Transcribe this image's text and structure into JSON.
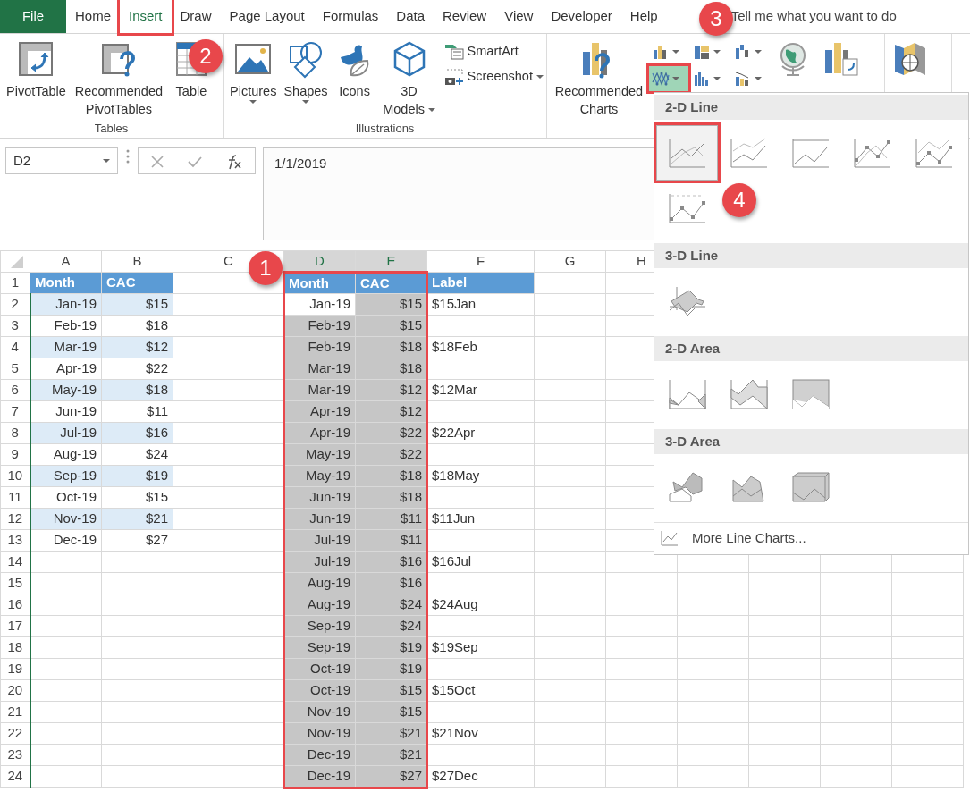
{
  "ribbon_tabs": [
    {
      "label": "File",
      "kind": "file",
      "selected": false,
      "annotated": false
    },
    {
      "label": "Home",
      "kind": "tab",
      "selected": false,
      "annotated": false
    },
    {
      "label": "Insert",
      "kind": "tab",
      "selected": true,
      "annotated": true
    },
    {
      "label": "Draw",
      "kind": "tab",
      "selected": false,
      "annotated": false
    },
    {
      "label": "Page Layout",
      "kind": "tab",
      "selected": false,
      "annotated": false
    },
    {
      "label": "Formulas",
      "kind": "tab",
      "selected": false,
      "annotated": false
    },
    {
      "label": "Data",
      "kind": "tab",
      "selected": false,
      "annotated": false
    },
    {
      "label": "Review",
      "kind": "tab",
      "selected": false,
      "annotated": false
    },
    {
      "label": "View",
      "kind": "tab",
      "selected": false,
      "annotated": false
    },
    {
      "label": "Developer",
      "kind": "tab",
      "selected": false,
      "annotated": false
    },
    {
      "label": "Help",
      "kind": "tab",
      "selected": false,
      "annotated": false
    }
  ],
  "tell_me": "Tell me what you want to do",
  "ribbon_groups": [
    {
      "label": "Tables",
      "buttons": [
        {
          "kind": "pivottable",
          "label": "PivotTable"
        },
        {
          "kind": "recpivot",
          "label": "Recommended PivotTables"
        },
        {
          "kind": "table",
          "label": "Table"
        }
      ]
    },
    {
      "label": "Illustrations",
      "buttons": [
        {
          "kind": "pictures",
          "label": "Pictures",
          "caret": true
        },
        {
          "kind": "shapes",
          "label": "Shapes",
          "caret": true
        },
        {
          "kind": "icons",
          "label": "Icons",
          "caret": false
        },
        {
          "kind": "models",
          "label": "3D Models",
          "caret": true
        }
      ],
      "small_buttons": [
        {
          "kind": "smartart",
          "label": "SmartArt",
          "caret": false
        },
        {
          "kind": "screenshot",
          "label": "Screenshot",
          "caret": true
        }
      ]
    },
    {
      "buttons": [
        {
          "kind": "recchart",
          "label": "Recommended Charts"
        }
      ],
      "chart_buttons": [
        {
          "kind": "column",
          "selected": false,
          "annotated": false
        },
        {
          "kind": "hierarchy",
          "selected": false,
          "annotated": false
        },
        {
          "kind": "waterfall",
          "selected": false,
          "annotated": false
        },
        {
          "kind": "line",
          "selected": true,
          "annotated": true
        },
        {
          "kind": "bars",
          "selected": false,
          "annotated": false
        },
        {
          "kind": "combo",
          "selected": false,
          "annotated": false
        }
      ],
      "more_buttons": [
        {
          "kind": "maps"
        },
        {
          "kind": "pivotchart"
        }
      ]
    },
    {
      "buttons": [
        {
          "kind": "map3d"
        }
      ]
    }
  ],
  "name_box": "D2",
  "formula": "1/1/2019",
  "columns": [
    {
      "label": "A",
      "selected": false
    },
    {
      "label": "B",
      "selected": false
    },
    {
      "label": "C",
      "selected": false
    },
    {
      "label": "D",
      "selected": true
    },
    {
      "label": "E",
      "selected": true
    },
    {
      "label": "F",
      "selected": false
    },
    {
      "label": "G",
      "selected": false
    },
    {
      "label": "H",
      "selected": false
    }
  ],
  "range_outlined": true,
  "rows": [
    {
      "num": "1",
      "selected": false,
      "cells": [
        {
          "text": "Month",
          "kind": "header"
        },
        {
          "text": "CAC",
          "kind": "header"
        },
        null,
        {
          "text": "Month",
          "kind": "header"
        },
        {
          "text": "CAC",
          "kind": "header"
        },
        {
          "text": "Label",
          "kind": "header"
        },
        null,
        null
      ]
    },
    {
      "num": "2",
      "selected": true,
      "cells": [
        {
          "text": "Jan-19",
          "kind": "band",
          "right_aligned": true
        },
        {
          "text": "$15",
          "kind": "band",
          "right_aligned": true
        },
        null,
        {
          "text": "Jan-19",
          "kind": "active",
          "right_aligned": true
        },
        {
          "text": "$15",
          "kind": "sel",
          "right_aligned": true
        },
        {
          "text": "$15Jan",
          "kind": "plain"
        },
        null,
        null
      ]
    },
    {
      "num": "3",
      "selected": true,
      "cells": [
        {
          "text": "Feb-19",
          "kind": "plain",
          "right_aligned": true
        },
        {
          "text": "$18",
          "kind": "plain",
          "right_aligned": true
        },
        null,
        {
          "text": "Feb-19",
          "kind": "sel",
          "right_aligned": true
        },
        {
          "text": "$15",
          "kind": "sel",
          "right_aligned": true
        },
        null,
        null,
        null
      ]
    },
    {
      "num": "4",
      "selected": true,
      "cells": [
        {
          "text": "Mar-19",
          "kind": "band",
          "right_aligned": true
        },
        {
          "text": "$12",
          "kind": "band",
          "right_aligned": true
        },
        null,
        {
          "text": "Feb-19",
          "kind": "sel",
          "right_aligned": true
        },
        {
          "text": "$18",
          "kind": "sel",
          "right_aligned": true
        },
        {
          "text": "$18Feb",
          "kind": "plain"
        },
        null,
        null
      ]
    },
    {
      "num": "5",
      "selected": true,
      "cells": [
        {
          "text": "Apr-19",
          "kind": "plain",
          "right_aligned": true
        },
        {
          "text": "$22",
          "kind": "plain",
          "right_aligned": true
        },
        null,
        {
          "text": "Mar-19",
          "kind": "sel",
          "right_aligned": true
        },
        {
          "text": "$18",
          "kind": "sel",
          "right_aligned": true
        },
        null,
        null,
        null
      ]
    },
    {
      "num": "6",
      "selected": true,
      "cells": [
        {
          "text": "May-19",
          "kind": "band",
          "right_aligned": true
        },
        {
          "text": "$18",
          "kind": "band",
          "right_aligned": true
        },
        null,
        {
          "text": "Mar-19",
          "kind": "sel",
          "right_aligned": true
        },
        {
          "text": "$12",
          "kind": "sel",
          "right_aligned": true
        },
        {
          "text": "$12Mar",
          "kind": "plain"
        },
        null,
        null
      ]
    },
    {
      "num": "7",
      "selected": true,
      "cells": [
        {
          "text": "Jun-19",
          "kind": "plain",
          "right_aligned": true
        },
        {
          "text": "$11",
          "kind": "plain",
          "right_aligned": true
        },
        null,
        {
          "text": "Apr-19",
          "kind": "sel",
          "right_aligned": true
        },
        {
          "text": "$12",
          "kind": "sel",
          "right_aligned": true
        },
        null,
        null,
        null
      ]
    },
    {
      "num": "8",
      "selected": true,
      "cells": [
        {
          "text": "Jul-19",
          "kind": "band",
          "right_aligned": true
        },
        {
          "text": "$16",
          "kind": "band",
          "right_aligned": true
        },
        null,
        {
          "text": "Apr-19",
          "kind": "sel",
          "right_aligned": true
        },
        {
          "text": "$22",
          "kind": "sel",
          "right_aligned": true
        },
        {
          "text": "$22Apr",
          "kind": "plain"
        },
        null,
        null
      ]
    },
    {
      "num": "9",
      "selected": true,
      "cells": [
        {
          "text": "Aug-19",
          "kind": "plain",
          "right_aligned": true
        },
        {
          "text": "$24",
          "kind": "plain",
          "right_aligned": true
        },
        null,
        {
          "text": "May-19",
          "kind": "sel",
          "right_aligned": true
        },
        {
          "text": "$22",
          "kind": "sel",
          "right_aligned": true
        },
        null,
        null,
        null
      ]
    },
    {
      "num": "10",
      "selected": true,
      "cells": [
        {
          "text": "Sep-19",
          "kind": "band",
          "right_aligned": true
        },
        {
          "text": "$19",
          "kind": "band",
          "right_aligned": true
        },
        null,
        {
          "text": "May-19",
          "kind": "sel",
          "right_aligned": true
        },
        {
          "text": "$18",
          "kind": "sel",
          "right_aligned": true
        },
        {
          "text": "$18May",
          "kind": "plain"
        },
        null,
        null
      ]
    },
    {
      "num": "11",
      "selected": true,
      "cells": [
        {
          "text": "Oct-19",
          "kind": "plain",
          "right_aligned": true
        },
        {
          "text": "$15",
          "kind": "plain",
          "right_aligned": true
        },
        null,
        {
          "text": "Jun-19",
          "kind": "sel",
          "right_aligned": true
        },
        {
          "text": "$18",
          "kind": "sel",
          "right_aligned": true
        },
        null,
        null,
        null
      ]
    },
    {
      "num": "12",
      "selected": true,
      "cells": [
        {
          "text": "Nov-19",
          "kind": "band",
          "right_aligned": true
        },
        {
          "text": "$21",
          "kind": "band",
          "right_aligned": true
        },
        null,
        {
          "text": "Jun-19",
          "kind": "sel",
          "right_aligned": true
        },
        {
          "text": "$11",
          "kind": "sel",
          "right_aligned": true
        },
        {
          "text": "$11Jun",
          "kind": "plain"
        },
        null,
        null
      ]
    },
    {
      "num": "13",
      "selected": true,
      "cells": [
        {
          "text": "Dec-19",
          "kind": "plain",
          "right_aligned": true
        },
        {
          "text": "$27",
          "kind": "plain",
          "right_aligned": true
        },
        null,
        {
          "text": "Jul-19",
          "kind": "sel",
          "right_aligned": true
        },
        {
          "text": "$11",
          "kind": "sel",
          "right_aligned": true
        },
        null,
        null,
        null
      ]
    },
    {
      "num": "14",
      "selected": true,
      "cells": [
        null,
        null,
        null,
        {
          "text": "Jul-19",
          "kind": "sel",
          "right_aligned": true
        },
        {
          "text": "$16",
          "kind": "sel",
          "right_aligned": true
        },
        {
          "text": "$16Jul",
          "kind": "plain"
        },
        null,
        null
      ]
    },
    {
      "num": "15",
      "selected": true,
      "cells": [
        null,
        null,
        null,
        {
          "text": "Aug-19",
          "kind": "sel",
          "right_aligned": true
        },
        {
          "text": "$16",
          "kind": "sel",
          "right_aligned": true
        },
        null,
        null,
        null
      ]
    },
    {
      "num": "16",
      "selected": true,
      "cells": [
        null,
        null,
        null,
        {
          "text": "Aug-19",
          "kind": "sel",
          "right_aligned": true
        },
        {
          "text": "$24",
          "kind": "sel",
          "right_aligned": true
        },
        {
          "text": "$24Aug",
          "kind": "plain"
        },
        null,
        null
      ]
    },
    {
      "num": "17",
      "selected": true,
      "cells": [
        null,
        null,
        null,
        {
          "text": "Sep-19",
          "kind": "sel",
          "right_aligned": true
        },
        {
          "text": "$24",
          "kind": "sel",
          "right_aligned": true
        },
        null,
        null,
        null
      ]
    },
    {
      "num": "18",
      "selected": true,
      "cells": [
        null,
        null,
        null,
        {
          "text": "Sep-19",
          "kind": "sel",
          "right_aligned": true
        },
        {
          "text": "$19",
          "kind": "sel",
          "right_aligned": true
        },
        {
          "text": "$19Sep",
          "kind": "plain"
        },
        null,
        null
      ]
    },
    {
      "num": "19",
      "selected": true,
      "cells": [
        null,
        null,
        null,
        {
          "text": "Oct-19",
          "kind": "sel",
          "right_aligned": true
        },
        {
          "text": "$19",
          "kind": "sel",
          "right_aligned": true
        },
        null,
        null,
        null
      ]
    },
    {
      "num": "20",
      "selected": true,
      "cells": [
        null,
        null,
        null,
        {
          "text": "Oct-19",
          "kind": "sel",
          "right_aligned": true
        },
        {
          "text": "$15",
          "kind": "sel",
          "right_aligned": true
        },
        {
          "text": "$15Oct",
          "kind": "plain"
        },
        null,
        null
      ]
    },
    {
      "num": "21",
      "selected": true,
      "cells": [
        null,
        null,
        null,
        {
          "text": "Nov-19",
          "kind": "sel",
          "right_aligned": true
        },
        {
          "text": "$15",
          "kind": "sel",
          "right_aligned": true
        },
        null,
        null,
        null
      ]
    },
    {
      "num": "22",
      "selected": true,
      "cells": [
        null,
        null,
        null,
        {
          "text": "Nov-19",
          "kind": "sel",
          "right_aligned": true
        },
        {
          "text": "$21",
          "kind": "sel",
          "right_aligned": true
        },
        {
          "text": "$21Nov",
          "kind": "plain"
        },
        null,
        null
      ]
    },
    {
      "num": "23",
      "selected": true,
      "cells": [
        null,
        null,
        null,
        {
          "text": "Dec-19",
          "kind": "sel",
          "right_aligned": true
        },
        {
          "text": "$21",
          "kind": "sel",
          "right_aligned": true
        },
        null,
        null,
        null
      ]
    },
    {
      "num": "24",
      "selected": true,
      "cells": [
        null,
        null,
        null,
        {
          "text": "Dec-19",
          "kind": "sel",
          "right_aligned": true
        },
        {
          "text": "$27",
          "kind": "sel",
          "right_aligned": true
        },
        {
          "text": "$27Dec",
          "kind": "plain"
        },
        null,
        null
      ]
    }
  ],
  "dropdown": {
    "sections": [
      {
        "title": "2-D Line",
        "items": [
          {
            "kind": "line",
            "selected": true,
            "annotated": true
          },
          {
            "kind": "stacked-line",
            "selected": false,
            "annotated": false
          },
          {
            "kind": "pct-line",
            "selected": false,
            "annotated": false
          },
          {
            "kind": "line-markers",
            "selected": false,
            "annotated": false
          },
          {
            "kind": "stacked-line-markers",
            "selected": false,
            "annotated": false
          },
          {
            "kind": "pct-line-markers",
            "selected": false,
            "annotated": false
          }
        ]
      },
      {
        "title": "3-D Line",
        "items": [
          {
            "kind": "line-3d",
            "selected": false,
            "annotated": false
          }
        ]
      },
      {
        "title": "2-D Area",
        "items": [
          {
            "kind": "area",
            "selected": false,
            "annotated": false
          },
          {
            "kind": "stacked-area",
            "selected": false,
            "annotated": false
          },
          {
            "kind": "pct-area",
            "selected": false,
            "annotated": false
          }
        ]
      },
      {
        "title": "3-D Area",
        "items": [
          {
            "kind": "area-3d",
            "selected": false,
            "annotated": false
          },
          {
            "kind": "stacked-area-3d",
            "selected": false,
            "annotated": false
          },
          {
            "kind": "pct-area-3d",
            "selected": false,
            "annotated": false
          }
        ]
      }
    ],
    "more": "More Line Charts..."
  },
  "callouts": [
    "1",
    "2",
    "3",
    "4"
  ]
}
